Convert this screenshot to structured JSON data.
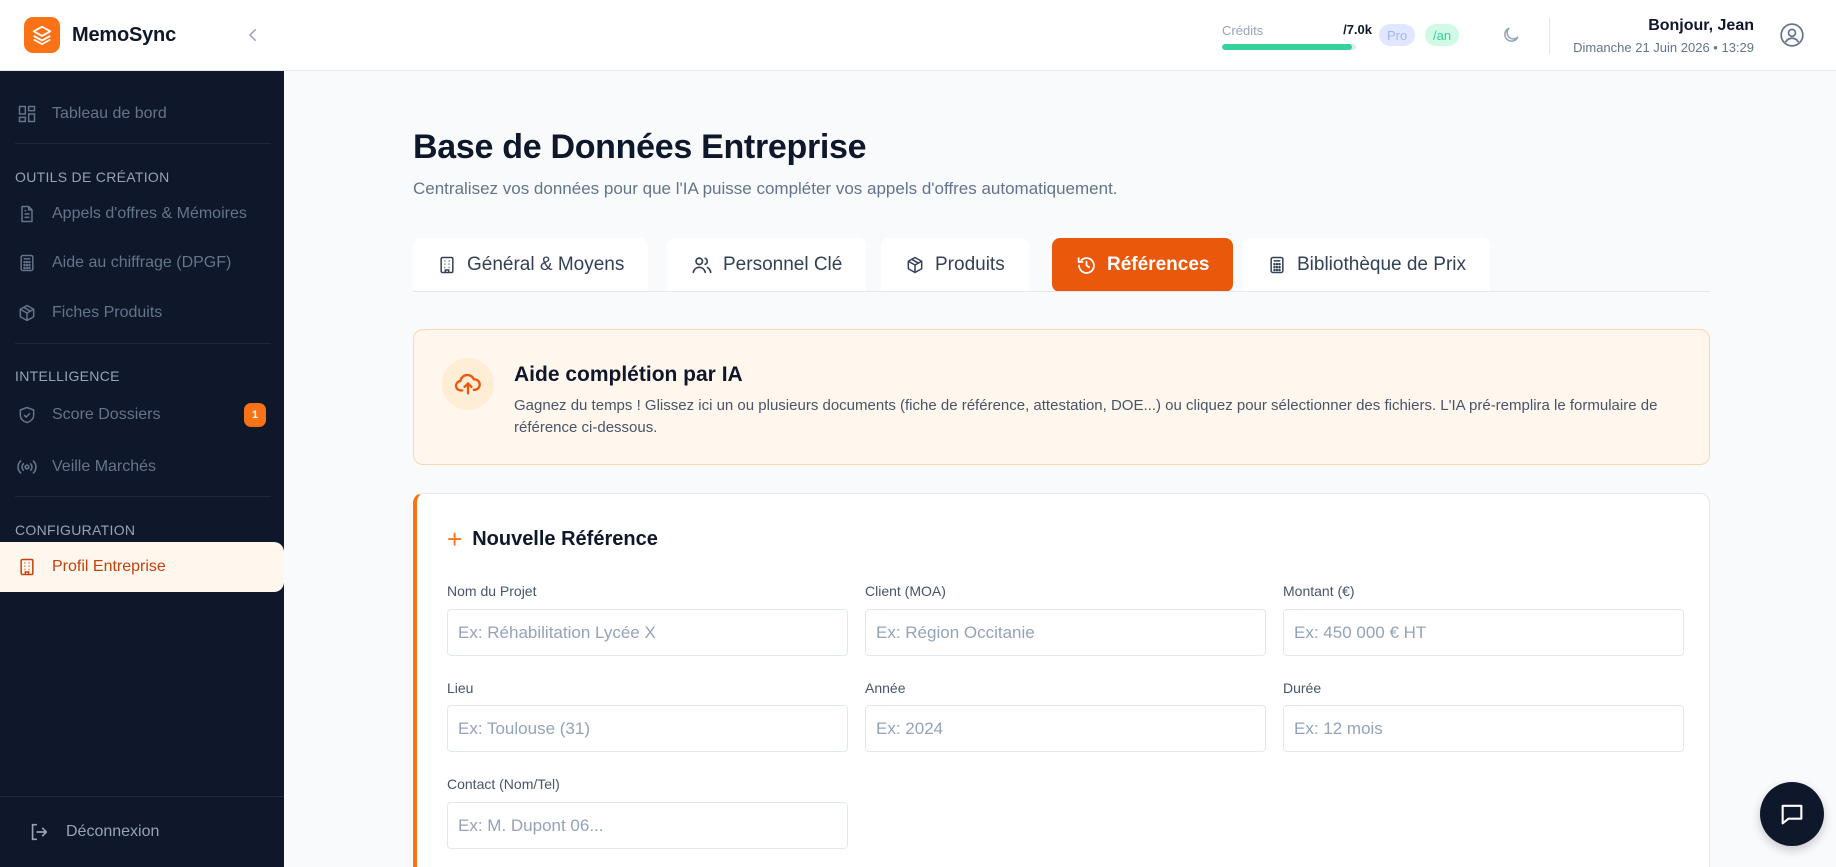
{
  "brand": {
    "name": "MemoSync"
  },
  "sidebar": {
    "dashboard": "Tableau de bord",
    "section_tools": "OUTILS DE CRÉATION",
    "tools": [
      {
        "label": "Appels d'offres & Mémoires",
        "icon": "document-icon"
      },
      {
        "label": "Aide au chiffrage (DPGF)",
        "icon": "calculator-icon"
      },
      {
        "label": "Fiches Produits",
        "icon": "box-icon"
      }
    ],
    "section_intel": "INTELLIGENCE",
    "intel": [
      {
        "label": "Score Dossiers",
        "icon": "shield-check-icon",
        "badge": "1"
      },
      {
        "label": "Veille Marchés",
        "icon": "broadcast-icon"
      }
    ],
    "section_config": "CONFIGURATION",
    "config": [
      {
        "label": "Profil Entreprise",
        "icon": "building-icon",
        "active": true
      }
    ],
    "logout": "Déconnexion"
  },
  "topbar": {
    "credits_label": "Crédits",
    "credits_value": "/7.0k",
    "credits_fraction": 0.97,
    "plan_pro": "Pro",
    "plan_period": "/an",
    "greeting": "Bonjour, Jean",
    "date": "Dimanche 21 Juin 2026 • 13:29"
  },
  "page": {
    "title": "Base de Données Entreprise",
    "subtitle": "Centralisez vos données pour que l'IA puisse compléter vos appels d'offres automatiquement."
  },
  "tabs": [
    {
      "label": "Général & Moyens",
      "icon": "building-icon"
    },
    {
      "label": "Personnel Clé",
      "icon": "users-icon"
    },
    {
      "label": "Produits",
      "icon": "box-icon"
    },
    {
      "label": "Références",
      "icon": "history-icon",
      "active": true
    },
    {
      "label": "Bibliothèque de Prix",
      "icon": "calculator-icon"
    }
  ],
  "ai_help": {
    "title": "Aide complétion par IA",
    "description": "Gagnez du temps ! Glissez ici un ou plusieurs documents (fiche de référence, attestation, DOE...) ou cliquez pour sélectionner des fichiers. L'IA pré-remplira le formulaire de référence ci-dessous."
  },
  "form": {
    "title": "Nouvelle Référence",
    "fields": {
      "project": {
        "label": "Nom du Projet",
        "placeholder": "Ex: Réhabilitation Lycée X",
        "value": ""
      },
      "client": {
        "label": "Client (MOA)",
        "placeholder": "Ex: Région Occitanie",
        "value": ""
      },
      "amount": {
        "label": "Montant (€)",
        "placeholder": "Ex: 450 000 € HT",
        "value": ""
      },
      "location": {
        "label": "Lieu",
        "placeholder": "Ex: Toulouse (31)",
        "value": ""
      },
      "year": {
        "label": "Année",
        "placeholder": "Ex: 2024",
        "value": ""
      },
      "duration": {
        "label": "Durée",
        "placeholder": "Ex: 12 mois",
        "value": ""
      },
      "contact": {
        "label": "Contact (Nom/Tel)",
        "placeholder": "Ex: M. Dupont 06...",
        "value": ""
      }
    }
  },
  "colors": {
    "accent": "#ea580c",
    "sidebar_bg": "#0f172a",
    "credits_bar": "#34d399"
  }
}
